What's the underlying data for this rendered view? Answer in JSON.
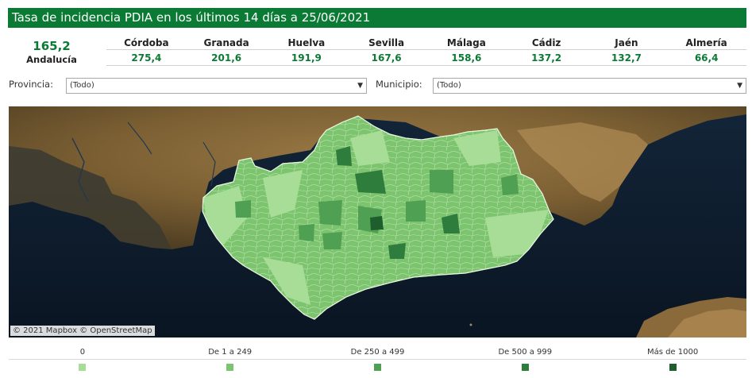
{
  "title": "Tasa de incidencia PDIA en los últimos 14 días a 25/06/2021",
  "total": {
    "value": "165,2",
    "label": "Andalucía"
  },
  "provinces": [
    {
      "name": "Córdoba",
      "value": "275,4"
    },
    {
      "name": "Granada",
      "value": "201,6"
    },
    {
      "name": "Huelva",
      "value": "191,9"
    },
    {
      "name": "Sevilla",
      "value": "167,6"
    },
    {
      "name": "Málaga",
      "value": "158,6"
    },
    {
      "name": "Cádiz",
      "value": "137,2"
    },
    {
      "name": "Jaén",
      "value": "132,7"
    },
    {
      "name": "Almería",
      "value": "66,4"
    }
  ],
  "filters": {
    "province": {
      "label": "Provincia:",
      "value": "(Todo)"
    },
    "municipality": {
      "label": "Municipio:",
      "value": "(Todo)"
    }
  },
  "map": {
    "attribution": "© 2021 Mapbox © OpenStreetMap"
  },
  "legend": [
    {
      "label": "0",
      "color": "#a8dd98"
    },
    {
      "label": "De 1 a 249",
      "color": "#7cc46e"
    },
    {
      "label": "De 250 a 499",
      "color": "#4fa052"
    },
    {
      "label": "De 500 a 999",
      "color": "#2e7d3c"
    },
    {
      "label": "Más de 1000",
      "color": "#1e5e2d"
    }
  ]
}
